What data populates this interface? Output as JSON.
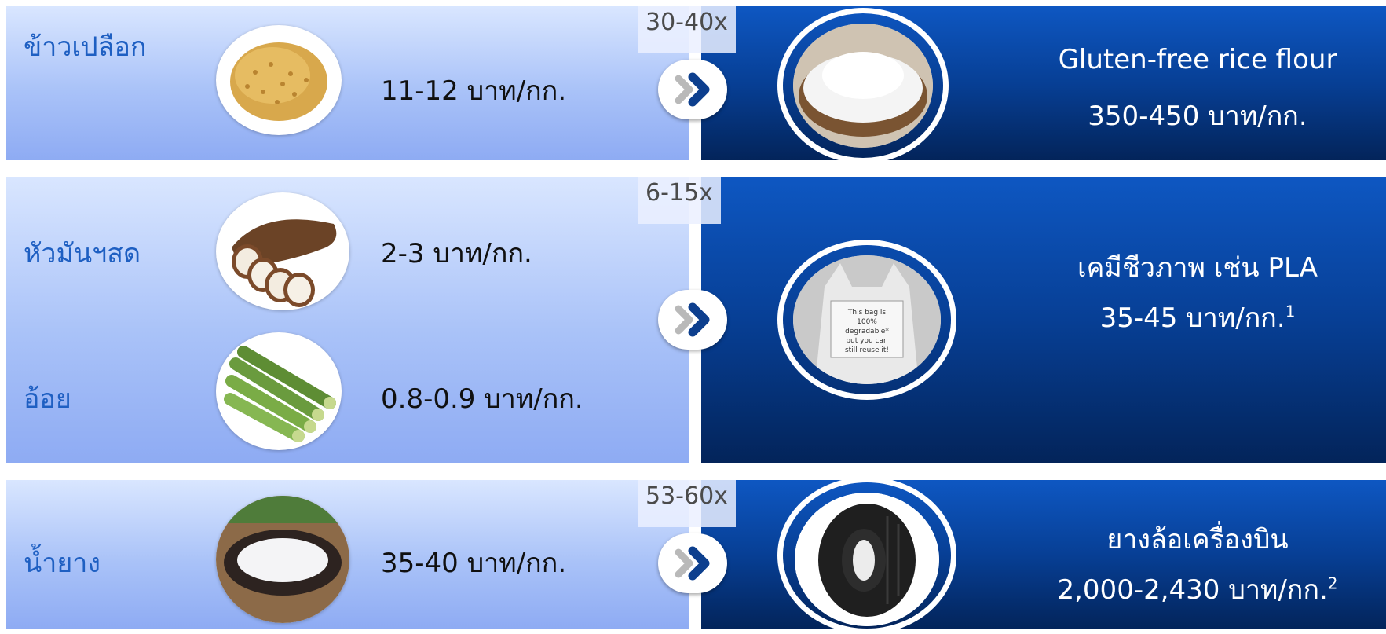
{
  "rows": [
    {
      "multiplier": "30-40x",
      "inputs": [
        {
          "label": "ข้าวเปลือก",
          "price": "11-12 บาท/กก."
        }
      ],
      "output": {
        "name": "Gluten-free rice flour",
        "price": "350-450 บาท/กก.",
        "note": ""
      }
    },
    {
      "multiplier": "6-15x",
      "inputs": [
        {
          "label": "หัวมันฯสด",
          "price": "2-3 บาท/กก."
        },
        {
          "label": "อ้อย",
          "price": "0.8-0.9 บาท/กก."
        }
      ],
      "output": {
        "name": "เคมีชีวภาพ เช่น PLA",
        "price": "35-45 บาท/กก.",
        "note": "1"
      }
    },
    {
      "multiplier": "53-60x",
      "inputs": [
        {
          "label": "น้ำยาง",
          "price": "35-40 บาท/กก."
        }
      ],
      "output": {
        "name": "ยางล้อเครื่องบิน",
        "price": "2,000-2,430 บาท/กก.",
        "note": "2"
      }
    }
  ],
  "bag_text": "This bag is 100% degradable* but you can still reuse it!",
  "icons": [
    "paddy-rice-photo",
    "cassava-photo",
    "sugarcane-photo",
    "latex-photo",
    "rice-flour-photo",
    "bioplastic-bag-photo",
    "aircraft-tire-photo",
    "double-chevron-icon"
  ],
  "colors": {
    "label": "#1e5fc2",
    "panel_dark": "#073f95",
    "panel_light": "#a9c2f8"
  }
}
